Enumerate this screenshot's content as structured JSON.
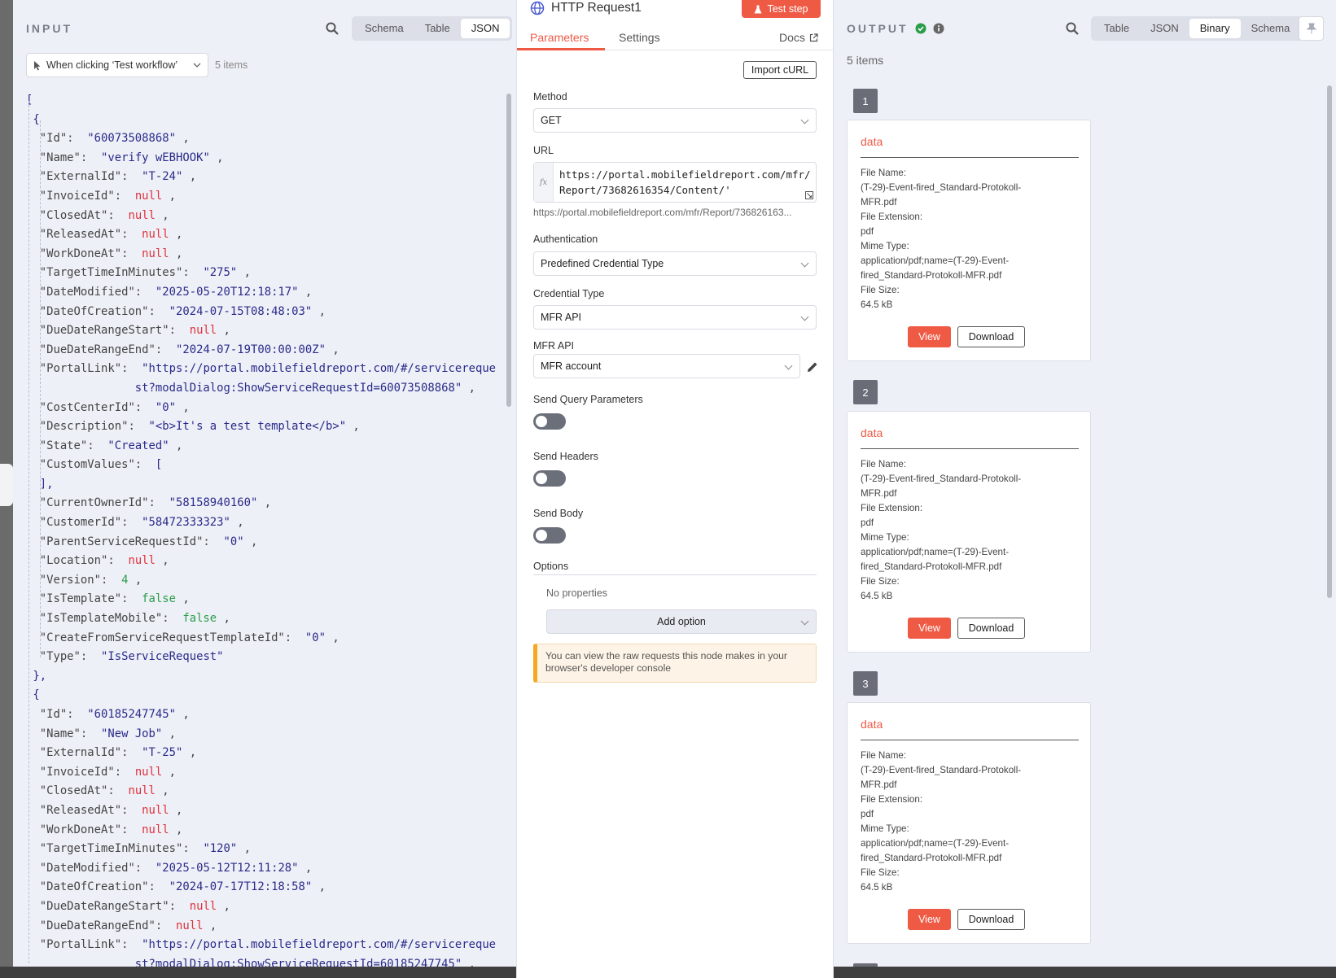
{
  "input": {
    "title": "INPUT",
    "view_tabs": [
      "Schema",
      "Table",
      "JSON"
    ],
    "active_view": "JSON",
    "trigger_select": "When clicking ‘Test workflow’",
    "items_count": "5 items",
    "json_lines": [
      [
        [
          "p",
          "["
        ]
      ],
      [
        [
          "p",
          " {"
        ]
      ],
      [
        [
          "k",
          "  \"Id\": "
        ],
        [
          "s",
          " \"60073508868\""
        ],
        [
          "k",
          " ,"
        ]
      ],
      [
        [
          "k",
          "  \"Name\": "
        ],
        [
          "s",
          " \"verify wEBHOOK\""
        ],
        [
          "k",
          " ,"
        ]
      ],
      [
        [
          "k",
          "  \"ExternalId\": "
        ],
        [
          "s",
          " \"T-24\""
        ],
        [
          "k",
          " ,"
        ]
      ],
      [
        [
          "k",
          "  \"InvoiceId\": "
        ],
        [
          "nl",
          " null"
        ],
        [
          "k",
          " ,"
        ]
      ],
      [
        [
          "k",
          "  \"ClosedAt\": "
        ],
        [
          "nl",
          " null"
        ],
        [
          "k",
          " ,"
        ]
      ],
      [
        [
          "k",
          "  \"ReleasedAt\": "
        ],
        [
          "nl",
          " null"
        ],
        [
          "k",
          " ,"
        ]
      ],
      [
        [
          "k",
          "  \"WorkDoneAt\": "
        ],
        [
          "nl",
          " null"
        ],
        [
          "k",
          " ,"
        ]
      ],
      [
        [
          "k",
          "  \"TargetTimeInMinutes\": "
        ],
        [
          "s",
          " \"275\""
        ],
        [
          "k",
          " ,"
        ]
      ],
      [
        [
          "k",
          "  \"DateModified\": "
        ],
        [
          "s",
          " \"2025-05-20T12:18:17\""
        ],
        [
          "k",
          " ,"
        ]
      ],
      [
        [
          "k",
          "  \"DateOfCreation\": "
        ],
        [
          "s",
          " \"2024-07-15T08:48:03\""
        ],
        [
          "k",
          " ,"
        ]
      ],
      [
        [
          "k",
          "  \"DueDateRangeStart\": "
        ],
        [
          "nl",
          " null"
        ],
        [
          "k",
          " ,"
        ]
      ],
      [
        [
          "k",
          "  \"DueDateRangeEnd\": "
        ],
        [
          "s",
          " \"2024-07-19T00:00:00Z\""
        ],
        [
          "k",
          " ,"
        ]
      ],
      [
        [
          "k",
          "  \"PortalLink\": "
        ],
        [
          "s",
          " \"https://portal.mobilefieldreport.com/#/servicereque"
        ]
      ],
      [
        [
          "s",
          "                st?modalDialog:ShowServiceRequestId=60073508868\""
        ],
        [
          "k",
          " ,"
        ]
      ],
      [
        [
          "k",
          "  \"CostCenterId\": "
        ],
        [
          "s",
          " \"0\""
        ],
        [
          "k",
          " ,"
        ]
      ],
      [
        [
          "k",
          "  \"Description\": "
        ],
        [
          "s",
          " \"<b>It's a test template</b>\""
        ],
        [
          "k",
          " ,"
        ]
      ],
      [
        [
          "k",
          "  \"State\": "
        ],
        [
          "s",
          " \"Created\""
        ],
        [
          "k",
          " ,"
        ]
      ],
      [
        [
          "k",
          "  \"CustomValues\": "
        ],
        [
          "p",
          " ["
        ]
      ],
      [
        [
          "p",
          "  ],"
        ]
      ],
      [
        [
          "k",
          "  \"CurrentOwnerId\": "
        ],
        [
          "s",
          " \"58158940160\""
        ],
        [
          "k",
          " ,"
        ]
      ],
      [
        [
          "k",
          "  \"CustomerId\": "
        ],
        [
          "s",
          " \"58472333323\""
        ],
        [
          "k",
          " ,"
        ]
      ],
      [
        [
          "k",
          "  \"ParentServiceRequestId\": "
        ],
        [
          "s",
          " \"0\""
        ],
        [
          "k",
          " ,"
        ]
      ],
      [
        [
          "k",
          "  \"Location\": "
        ],
        [
          "nl",
          " null"
        ],
        [
          "k",
          " ,"
        ]
      ],
      [
        [
          "k",
          "  \"Version\": "
        ],
        [
          "nb",
          " 4"
        ],
        [
          "k",
          " ,"
        ]
      ],
      [
        [
          "k",
          "  \"IsTemplate\": "
        ],
        [
          "nb",
          " false"
        ],
        [
          "k",
          " ,"
        ]
      ],
      [
        [
          "k",
          "  \"IsTemplateMobile\": "
        ],
        [
          "nb",
          " false"
        ],
        [
          "k",
          " ,"
        ]
      ],
      [
        [
          "k",
          "  \"CreateFromServiceRequestTemplateId\": "
        ],
        [
          "s",
          " \"0\""
        ],
        [
          "k",
          " ,"
        ]
      ],
      [
        [
          "k",
          "  \"Type\": "
        ],
        [
          "s",
          " \"IsServiceRequest\""
        ]
      ],
      [
        [
          "p",
          " },"
        ]
      ],
      [
        [
          "p",
          " {"
        ]
      ],
      [
        [
          "k",
          "  \"Id\": "
        ],
        [
          "s",
          " \"60185247745\""
        ],
        [
          "k",
          " ,"
        ]
      ],
      [
        [
          "k",
          "  \"Name\": "
        ],
        [
          "s",
          " \"New Job\""
        ],
        [
          "k",
          " ,"
        ]
      ],
      [
        [
          "k",
          "  \"ExternalId\": "
        ],
        [
          "s",
          " \"T-25\""
        ],
        [
          "k",
          " ,"
        ]
      ],
      [
        [
          "k",
          "  \"InvoiceId\": "
        ],
        [
          "nl",
          " null"
        ],
        [
          "k",
          " ,"
        ]
      ],
      [
        [
          "k",
          "  \"ClosedAt\": "
        ],
        [
          "nl",
          " null"
        ],
        [
          "k",
          " ,"
        ]
      ],
      [
        [
          "k",
          "  \"ReleasedAt\": "
        ],
        [
          "nl",
          " null"
        ],
        [
          "k",
          " ,"
        ]
      ],
      [
        [
          "k",
          "  \"WorkDoneAt\": "
        ],
        [
          "nl",
          " null"
        ],
        [
          "k",
          " ,"
        ]
      ],
      [
        [
          "k",
          "  \"TargetTimeInMinutes\": "
        ],
        [
          "s",
          " \"120\""
        ],
        [
          "k",
          " ,"
        ]
      ],
      [
        [
          "k",
          "  \"DateModified\": "
        ],
        [
          "s",
          " \"2025-05-12T12:11:28\""
        ],
        [
          "k",
          " ,"
        ]
      ],
      [
        [
          "k",
          "  \"DateOfCreation\": "
        ],
        [
          "s",
          " \"2024-07-17T12:18:58\""
        ],
        [
          "k",
          " ,"
        ]
      ],
      [
        [
          "k",
          "  \"DueDateRangeStart\": "
        ],
        [
          "nl",
          " null"
        ],
        [
          "k",
          " ,"
        ]
      ],
      [
        [
          "k",
          "  \"DueDateRangeEnd\": "
        ],
        [
          "nl",
          " null"
        ],
        [
          "k",
          " ,"
        ]
      ],
      [
        [
          "k",
          "  \"PortalLink\": "
        ],
        [
          "s",
          " \"https://portal.mobilefieldreport.com/#/servicereque"
        ]
      ],
      [
        [
          "s",
          "                st?modalDialog:ShowServiceRequestId=60185247745\""
        ],
        [
          "k",
          " ,"
        ]
      ]
    ]
  },
  "node": {
    "title": "HTTP Request1",
    "test_step": "Test step",
    "tabs": {
      "parameters": "Parameters",
      "settings": "Settings",
      "docs": "Docs"
    },
    "import_curl": "Import cURL",
    "method_label": "Method",
    "method_value": "GET",
    "url_label": "URL",
    "fx": "fx",
    "url_value": "https://portal.mobilefieldreport.com/mfr/Report/73682616354/Content/'",
    "url_preview": "https://portal.mobilefieldreport.com/mfr/Report/736826163...",
    "auth_label": "Authentication",
    "auth_value": "Predefined Credential Type",
    "cred_type_label": "Credential Type",
    "cred_type_value": "MFR API",
    "mfr_api_label": "MFR API",
    "mfr_api_value": "MFR account",
    "send_query_label": "Send Query Parameters",
    "send_headers_label": "Send Headers",
    "send_body_label": "Send Body",
    "options_label": "Options",
    "no_properties": "No properties",
    "add_option": "Add option",
    "notice": "You can view the raw requests this node makes in your browser's developer console"
  },
  "output": {
    "title": "OUTPUT",
    "view_tabs": [
      "Table",
      "JSON",
      "Binary",
      "Schema"
    ],
    "active_view": "Binary",
    "items_count": "5 items",
    "labels": {
      "file_name": "File Name:",
      "file_extension": "File Extension:",
      "mime_type": "Mime Type:",
      "file_size": "File Size:",
      "view": "View",
      "download": "Download"
    },
    "items": [
      {
        "index": "1",
        "title": "data",
        "file_name_1": "(T-29)-Event-fired_Standard-Protokoll-",
        "file_name_2": "MFR.pdf",
        "file_extension": "pdf",
        "mime_type_1": "application/pdf;name=(T-29)-Event-",
        "mime_type_2": "fired_Standard-Protokoll-MFR.pdf",
        "file_size": "64.5 kB"
      },
      {
        "index": "2",
        "title": "data",
        "file_name_1": "(T-29)-Event-fired_Standard-Protokoll-",
        "file_name_2": "MFR.pdf",
        "file_extension": "pdf",
        "mime_type_1": "application/pdf;name=(T-29)-Event-",
        "mime_type_2": "fired_Standard-Protokoll-MFR.pdf",
        "file_size": "64.5 kB"
      },
      {
        "index": "3",
        "title": "data",
        "file_name_1": "(T-29)-Event-fired_Standard-Protokoll-",
        "file_name_2": "MFR.pdf",
        "file_extension": "pdf",
        "mime_type_1": "application/pdf;name=(T-29)-Event-",
        "mime_type_2": "fired_Standard-Protokoll-MFR.pdf",
        "file_size": "64.5 kB"
      }
    ]
  },
  "colors": {
    "accent": "#ef5a45",
    "success": "#2a9d4a",
    "null": "#e0303a",
    "string": "#2a2a8a"
  },
  "icons": [
    "search-icon",
    "cursor-icon",
    "globe-icon",
    "flask-icon",
    "external-link-icon",
    "expand-icon",
    "pencil-icon",
    "check-circle-icon",
    "info-icon",
    "pin-icon"
  ]
}
